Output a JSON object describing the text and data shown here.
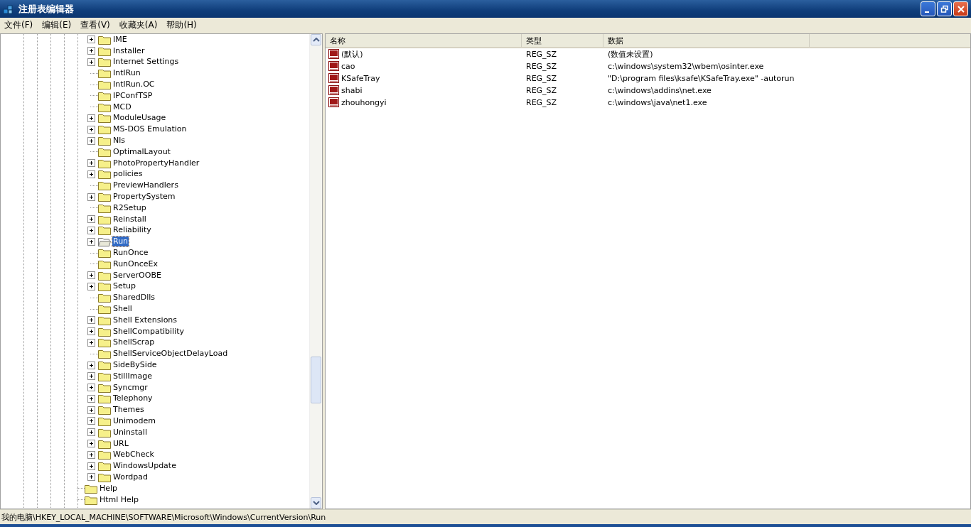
{
  "window": {
    "title": "注册表编辑器"
  },
  "menu": [
    {
      "label": "文件(F)"
    },
    {
      "label": "编辑(E)"
    },
    {
      "label": "查看(V)"
    },
    {
      "label": "收藏夹(A)"
    },
    {
      "label": "帮助(H)"
    }
  ],
  "tree": [
    {
      "children": [
        {
          "label": "IME",
          "expandable": true,
          "selected": false
        },
        {
          "label": "Installer",
          "expandable": true,
          "selected": false
        },
        {
          "label": "Internet Settings",
          "expandable": true,
          "selected": false
        },
        {
          "label": "IntlRun",
          "expandable": false,
          "selected": false
        },
        {
          "label": "IntlRun.OC",
          "expandable": false,
          "selected": false
        },
        {
          "label": "IPConfTSP",
          "expandable": false,
          "selected": false
        },
        {
          "label": "MCD",
          "expandable": false,
          "selected": false
        },
        {
          "label": "ModuleUsage",
          "expandable": true,
          "selected": false
        },
        {
          "label": "MS-DOS Emulation",
          "expandable": true,
          "selected": false
        },
        {
          "label": "Nls",
          "expandable": true,
          "selected": false
        },
        {
          "label": "OptimalLayout",
          "expandable": false,
          "selected": false
        },
        {
          "label": "PhotoPropertyHandler",
          "expandable": true,
          "selected": false
        },
        {
          "label": "policies",
          "expandable": true,
          "selected": false
        },
        {
          "label": "PreviewHandlers",
          "expandable": false,
          "selected": false
        },
        {
          "label": "PropertySystem",
          "expandable": true,
          "selected": false
        },
        {
          "label": "R2Setup",
          "expandable": false,
          "selected": false
        },
        {
          "label": "Reinstall",
          "expandable": true,
          "selected": false
        },
        {
          "label": "Reliability",
          "expandable": true,
          "selected": false
        },
        {
          "label": "Run",
          "expandable": true,
          "selected": true
        },
        {
          "label": "RunOnce",
          "expandable": false,
          "selected": false
        },
        {
          "label": "RunOnceEx",
          "expandable": false,
          "selected": false
        },
        {
          "label": "ServerOOBE",
          "expandable": true,
          "selected": false
        },
        {
          "label": "Setup",
          "expandable": true,
          "selected": false
        },
        {
          "label": "SharedDlls",
          "expandable": false,
          "selected": false
        },
        {
          "label": "Shell",
          "expandable": false,
          "selected": false
        },
        {
          "label": "Shell Extensions",
          "expandable": true,
          "selected": false
        },
        {
          "label": "ShellCompatibility",
          "expandable": true,
          "selected": false
        },
        {
          "label": "ShellScrap",
          "expandable": true,
          "selected": false
        },
        {
          "label": "ShellServiceObjectDelayLoad",
          "expandable": false,
          "selected": false
        },
        {
          "label": "SideBySide",
          "expandable": true,
          "selected": false
        },
        {
          "label": "StillImage",
          "expandable": true,
          "selected": false
        },
        {
          "label": "Syncmgr",
          "expandable": true,
          "selected": false
        },
        {
          "label": "Telephony",
          "expandable": true,
          "selected": false
        },
        {
          "label": "Themes",
          "expandable": true,
          "selected": false
        },
        {
          "label": "Unimodem",
          "expandable": true,
          "selected": false
        },
        {
          "label": "Uninstall",
          "expandable": true,
          "selected": false
        },
        {
          "label": "URL",
          "expandable": true,
          "selected": false
        },
        {
          "label": "WebCheck",
          "expandable": true,
          "selected": false
        },
        {
          "label": "WindowsUpdate",
          "expandable": true,
          "selected": false
        },
        {
          "label": "Wordpad",
          "expandable": true,
          "selected": false
        }
      ]
    },
    {
      "label": "Help",
      "expandable": false,
      "selected": false
    },
    {
      "label": "Html Help",
      "expandable": false,
      "selected": false
    }
  ],
  "table": {
    "columns": [
      "名称",
      "类型",
      "数据"
    ],
    "rows": [
      {
        "name": "(默认)",
        "type": "REG_SZ",
        "data": "(数值未设置)"
      },
      {
        "name": "cao",
        "type": "REG_SZ",
        "data": "c:\\windows\\system32\\wbem\\osinter.exe"
      },
      {
        "name": "KSafeTray",
        "type": "REG_SZ",
        "data": "\"D:\\program files\\ksafe\\KSafeTray.exe\" -autorun"
      },
      {
        "name": "shabi",
        "type": "REG_SZ",
        "data": "c:\\windows\\addins\\net.exe"
      },
      {
        "name": "zhouhongyi",
        "type": "REG_SZ",
        "data": "c:\\windows\\java\\net1.exe"
      }
    ]
  },
  "status_bar": {
    "computer": "我的电脑",
    "path": "\\HKEY_LOCAL_MACHINE\\SOFTWARE\\Microsoft\\Windows\\CurrentVersion\\Run"
  }
}
